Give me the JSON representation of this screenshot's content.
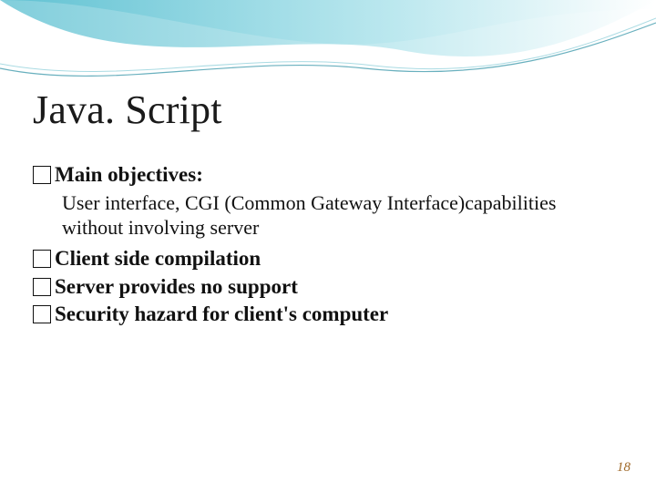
{
  "title": "Java. Script",
  "bullets": [
    {
      "text": "Main objectives:",
      "bold": true
    },
    {
      "text": "User interface, CGI (Common Gateway Interface)capabilities without involving server",
      "sub": true
    },
    {
      "text": "Client side compilation",
      "bold": true
    },
    {
      "text": "Server provides no support",
      "bold": true
    },
    {
      "text": "Security hazard for client's computer",
      "bold": true
    }
  ],
  "pageNumber": "18"
}
